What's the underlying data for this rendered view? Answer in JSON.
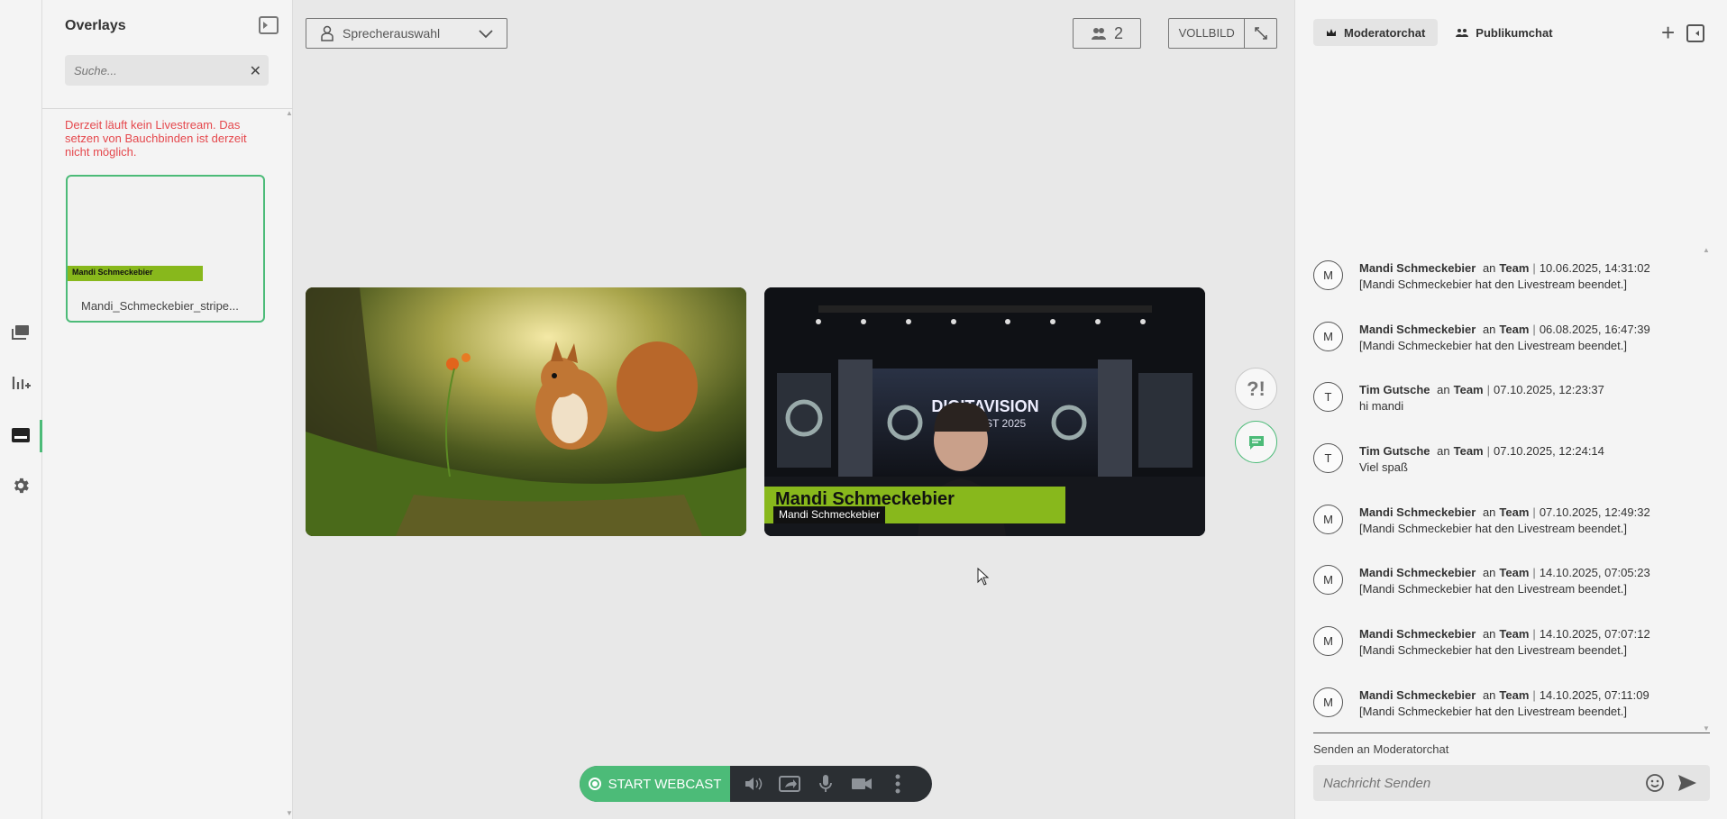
{
  "overlays": {
    "title": "Overlays",
    "search_placeholder": "Suche...",
    "warning": "Derzeit läuft kein Livestream. Das setzen von Bauchbinden ist derzeit nicht möglich.",
    "card": {
      "stripe_label": "Mandi Schmeckebier",
      "filename": "Mandi_Schmeckebier_stripe..."
    }
  },
  "main": {
    "speaker_select": "Sprecherauswahl",
    "participant_count": "2",
    "fullscreen_label": "VOLLBILD",
    "qa_label": "?!",
    "tile2": {
      "stage_title": "DIGITAVISION",
      "stage_subtitle": "FEST 2025",
      "lower_third_name": "Mandi Schmeckebier",
      "lower_third_sub": "Mandi Schmeckebier"
    },
    "start_webcast_label": "START WEBCAST"
  },
  "chat": {
    "tabs": [
      {
        "label": "Moderatorchat",
        "icon": "crown-icon",
        "active": true
      },
      {
        "label": "Publikumchat",
        "icon": "audience-icon",
        "active": false
      }
    ],
    "messages": [
      {
        "initial": "M",
        "author": "Mandi Schmeckebier",
        "to_word": "an",
        "target": "Team",
        "time": "10.06.2025, 14:31:02",
        "text": "[Mandi Schmeckebier hat den Livestream beendet.]"
      },
      {
        "initial": "M",
        "author": "Mandi Schmeckebier",
        "to_word": "an",
        "target": "Team",
        "time": "06.08.2025, 16:47:39",
        "text": "[Mandi Schmeckebier hat den Livestream beendet.]"
      },
      {
        "initial": "T",
        "author": "Tim Gutsche",
        "to_word": "an",
        "target": "Team",
        "time": "07.10.2025, 12:23:37",
        "text": "hi mandi"
      },
      {
        "initial": "T",
        "author": "Tim Gutsche",
        "to_word": "an",
        "target": "Team",
        "time": "07.10.2025, 12:24:14",
        "text": "Viel spaß"
      },
      {
        "initial": "M",
        "author": "Mandi Schmeckebier",
        "to_word": "an",
        "target": "Team",
        "time": "07.10.2025, 12:49:32",
        "text": "[Mandi Schmeckebier hat den Livestream beendet.]"
      },
      {
        "initial": "M",
        "author": "Mandi Schmeckebier",
        "to_word": "an",
        "target": "Team",
        "time": "14.10.2025, 07:05:23",
        "text": "[Mandi Schmeckebier hat den Livestream beendet.]"
      },
      {
        "initial": "M",
        "author": "Mandi Schmeckebier",
        "to_word": "an",
        "target": "Team",
        "time": "14.10.2025, 07:07:12",
        "text": "[Mandi Schmeckebier hat den Livestream beendet.]"
      },
      {
        "initial": "M",
        "author": "Mandi Schmeckebier",
        "to_word": "an",
        "target": "Team",
        "time": "14.10.2025, 07:11:09",
        "text": "[Mandi Schmeckebier hat den Livestream beendet.]"
      }
    ],
    "send_to_label": "Senden an Moderatorchat",
    "input_placeholder": "Nachricht Senden"
  },
  "colors": {
    "accent": "#4cbb78",
    "warning": "#e5484d",
    "lower_third": "#88b81c"
  }
}
